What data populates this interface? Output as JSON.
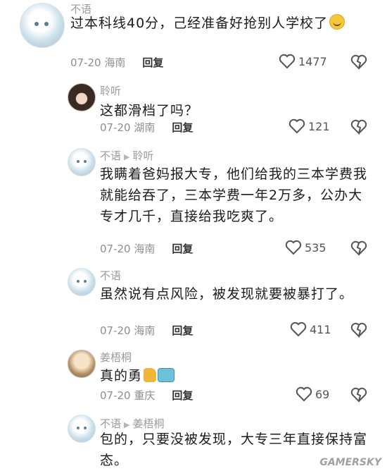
{
  "comments": [
    {
      "name": "不语",
      "text": "过本科线40分，己经准备好抢别人学校了",
      "location": "07-20 海南",
      "reply_label": "回复",
      "likes": "1477"
    },
    {
      "name": "聆听",
      "text": "这都滑档了吗？",
      "location": "07-20 湖南",
      "reply_label": "回复",
      "likes": "121"
    },
    {
      "name": "不语",
      "reply_to": "聆听",
      "text": "我瞒着爸妈报大专，他们给我的三本学费我就能给吞了，三本学费一年2万多，公办大专才几千，直接给我吃爽了。",
      "location": "07-20 海南",
      "reply_label": "回复",
      "likes": "535"
    },
    {
      "name": "不语",
      "text": "虽然说有点风险，被发现就要被暴打了。",
      "location": "07-20 海南",
      "reply_label": "回复",
      "likes": "411"
    },
    {
      "name": "姜梧桐",
      "text": "真的勇",
      "location": "07-20 重庆",
      "reply_label": "回复",
      "likes": "69"
    },
    {
      "name": "不语",
      "reply_to": "姜梧桐",
      "text": "包的，只要没被发现，大专三年直接保持富态。"
    }
  ],
  "icons": {
    "like": "heart-outline-icon",
    "dislike": "broken-heart-icon",
    "reply_arrow": "play-triangle-icon"
  },
  "watermark": "GAMERSKY",
  "colors": {
    "name": "#9a9a9a",
    "text": "#1b1b1b",
    "meta": "#8e8e8e"
  }
}
